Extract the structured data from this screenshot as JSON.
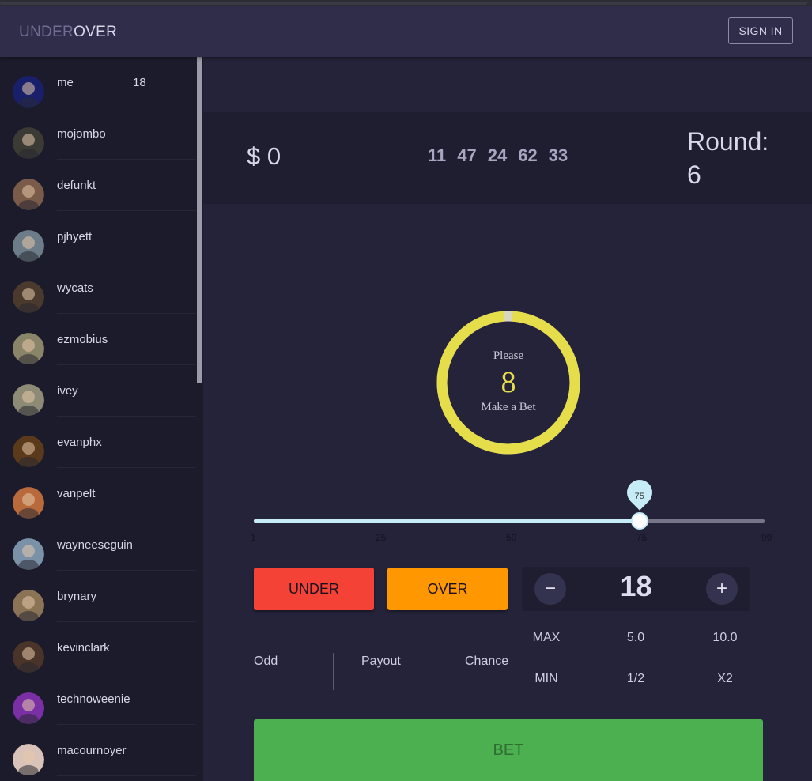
{
  "app": {
    "brand_prefix": "UNDER",
    "brand_suffix": "OVER",
    "signin_label": "SIGN IN"
  },
  "users": [
    {
      "name": "me",
      "score": "18",
      "avatar_color": "#1a1f6b"
    },
    {
      "name": "mojombo",
      "score": "",
      "avatar_color": "#3b3a35"
    },
    {
      "name": "defunkt",
      "score": "",
      "avatar_color": "#7a5a48"
    },
    {
      "name": "pjhyett",
      "score": "",
      "avatar_color": "#6c7c88"
    },
    {
      "name": "wycats",
      "score": "",
      "avatar_color": "#4a3a2d"
    },
    {
      "name": "ezmobius",
      "score": "",
      "avatar_color": "#8a8468"
    },
    {
      "name": "ivey",
      "score": "",
      "avatar_color": "#8d8a75"
    },
    {
      "name": "evanphx",
      "score": "",
      "avatar_color": "#5a3a1a"
    },
    {
      "name": "vanpelt",
      "score": "",
      "avatar_color": "#b86a3a"
    },
    {
      "name": "wayneeseguin",
      "score": "",
      "avatar_color": "#7b91a8"
    },
    {
      "name": "brynary",
      "score": "",
      "avatar_color": "#8b7356"
    },
    {
      "name": "kevinclark",
      "score": "",
      "avatar_color": "#4a3328"
    },
    {
      "name": "technoweenie",
      "score": "",
      "avatar_color": "#7a2fa5"
    },
    {
      "name": "macournoyer",
      "score": "",
      "avatar_color": "#d9c3b8"
    }
  ],
  "game": {
    "balance": "$ 0",
    "history": [
      "11",
      "47",
      "24",
      "62",
      "33"
    ],
    "round_label": "Round:",
    "round_value": "6",
    "timer_top": "Please",
    "timer_count": "8",
    "timer_bottom": "Make a Bet",
    "timer_progress": 0.98,
    "timer_color": "#e6dd4a"
  },
  "slider": {
    "value": 75,
    "min": 1,
    "max": 99,
    "ticks": [
      "1",
      "25",
      "50",
      "75",
      "99"
    ]
  },
  "actions": {
    "under_label": "UNDER",
    "over_label": "OVER",
    "under_color": "#f44336",
    "over_color": "#ff9800"
  },
  "stepper": {
    "value": "18",
    "minus_label": "−",
    "plus_label": "+"
  },
  "info": {
    "odd_label": "Odd",
    "payout_label": "Payout",
    "chance_label": "Chance"
  },
  "quick_bets": {
    "max_label": "MAX",
    "min_label": "MIN",
    "top_middle": "5.0",
    "top_right": "10.0",
    "bottom_middle": "1/2",
    "bottom_right": "X2"
  },
  "bet": {
    "label": "BET",
    "color": "#4caf50"
  }
}
